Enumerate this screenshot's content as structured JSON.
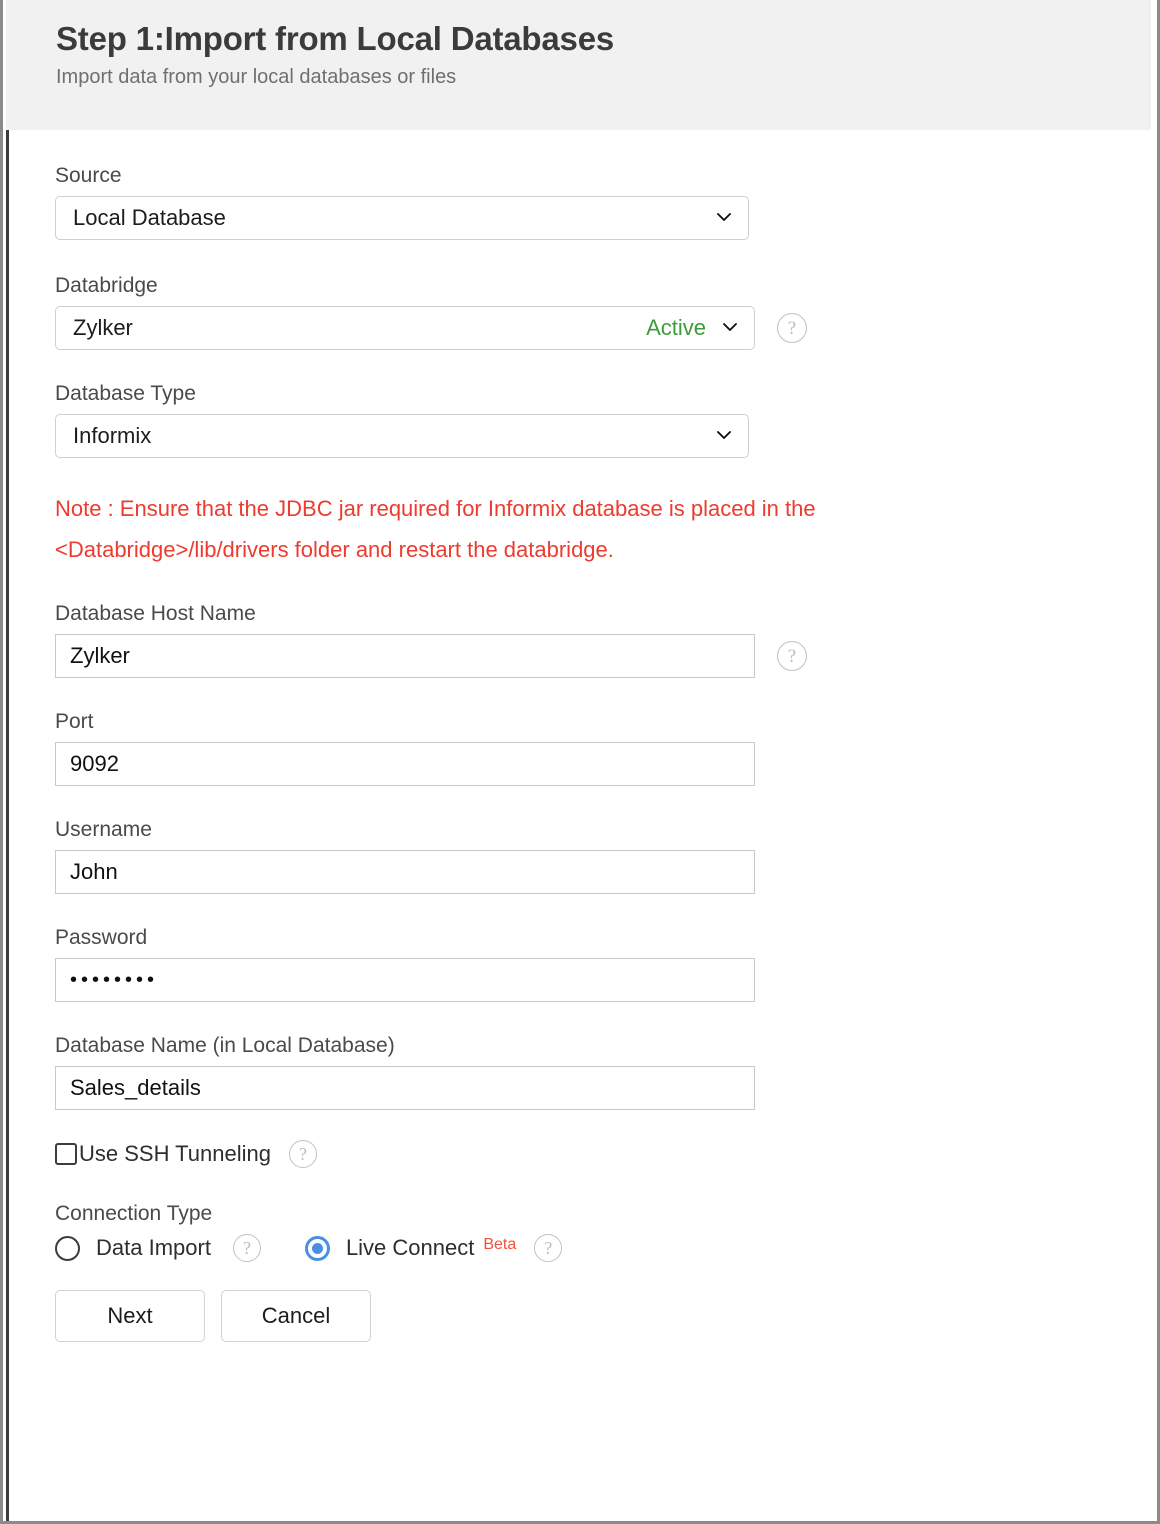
{
  "header": {
    "title": "Step 1:Import from Local Databases",
    "subtitle": "Import data from your local databases or files"
  },
  "form": {
    "source": {
      "label": "Source",
      "value": "Local Database",
      "chevron_icon": "chevron-down-icon"
    },
    "databridge": {
      "label": "Databridge",
      "value": "Zylker",
      "status": "Active",
      "status_color": "#3d9c3a",
      "chevron_icon": "chevron-down-icon",
      "help_icon": "help-question-icon",
      "help_glyph": "?"
    },
    "database_type": {
      "label": "Database Type",
      "value": "Informix",
      "chevron_icon": "chevron-down-icon"
    },
    "note": {
      "text": "Note : Ensure that the JDBC jar required for Informix database is placed in the <Databridge>/lib/drivers folder and restart the databridge.",
      "color": "#ed3b2f"
    },
    "host_name": {
      "label": "Database Host Name",
      "value": "Zylker",
      "placeholder": "",
      "help_icon": "help-question-icon",
      "help_glyph": "?"
    },
    "port": {
      "label": "Port",
      "value": "9092",
      "placeholder": ""
    },
    "username": {
      "label": "Username",
      "value": "John",
      "placeholder": ""
    },
    "password": {
      "label": "Password",
      "value": "••••••••",
      "placeholder": ""
    },
    "database_name": {
      "label": "Database Name (in Local Database)",
      "value": "Sales_details",
      "placeholder": ""
    },
    "ssh_tunneling": {
      "label": "Use SSH Tunneling",
      "checked": false,
      "help_icon": "help-question-icon",
      "help_glyph": "?"
    },
    "connection_type": {
      "label": "Connection Type",
      "options": [
        {
          "label": "Data Import",
          "selected": false,
          "badge": "",
          "help_glyph": "?"
        },
        {
          "label": "Live Connect",
          "selected": true,
          "badge": "Beta",
          "badge_color": "#f4503c",
          "help_glyph": "?"
        }
      ]
    }
  },
  "actions": {
    "next_label": "Next",
    "cancel_label": "Cancel"
  }
}
